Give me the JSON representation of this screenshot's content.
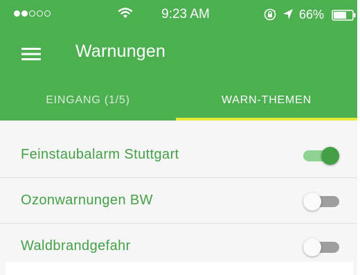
{
  "statusbar": {
    "time": "9:23 AM",
    "battery": "66%",
    "signal_dots": [
      true,
      true,
      false,
      false,
      false
    ],
    "icons": [
      "signal-dots-icon",
      "wifi-icon",
      "rotation-lock-icon",
      "location-arrow-icon",
      "battery-icon"
    ]
  },
  "appbar": {
    "title": "Warnungen",
    "menu_icon": "hamburger-menu-icon"
  },
  "tabs": [
    {
      "label": "EINGANG (1/5)",
      "selected": false
    },
    {
      "label": "WARN-THEMEN",
      "selected": true
    }
  ],
  "list": {
    "items": [
      {
        "label": "Feinstaubalarm Stuttgart",
        "enabled": true
      },
      {
        "label": "Ozonwarnungen BW",
        "enabled": false
      },
      {
        "label": "Waldbrandgefahr",
        "enabled": false
      }
    ]
  },
  "colors": {
    "primary": "#4caf50",
    "accent_text": "#43a047",
    "tab_indicator": "#e6ea3a",
    "toggle_on_track": "#8fd392",
    "toggle_off_track": "#9e9e9e"
  }
}
